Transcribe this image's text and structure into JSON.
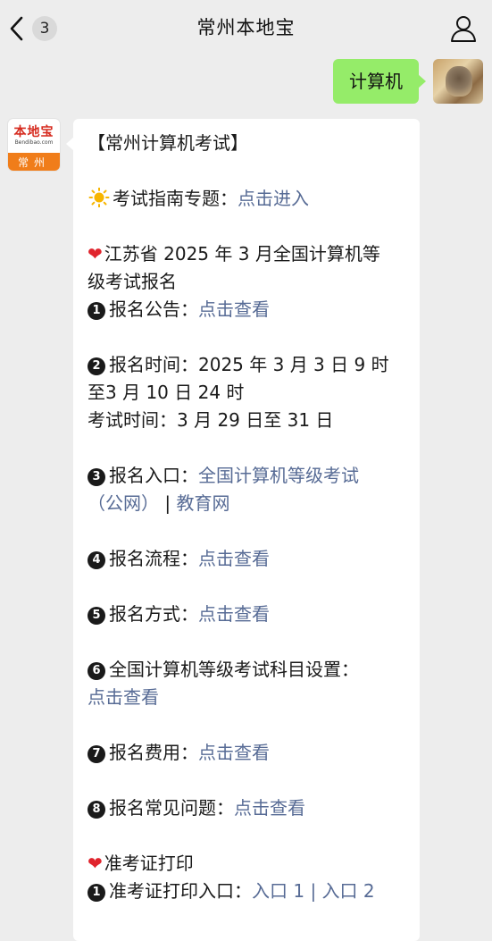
{
  "header": {
    "unread_count": "3",
    "title": "常州本地宝"
  },
  "outgoing": {
    "text": "计算机"
  },
  "bot_avatar": {
    "logo_text": "本地宝",
    "logo_sub": "Bendibao.com",
    "city": "常州"
  },
  "message": {
    "title": "【常州计算机考试】",
    "guide_label": "考试指南专题：",
    "guide_link": "点击进入",
    "reg_heading_1": "江苏省 2025 年 3 月全国计算机等",
    "reg_heading_2": "级考试报名",
    "items": [
      {
        "num": "1",
        "label": "报名公告：",
        "link": "点击查看"
      },
      {
        "num": "2",
        "label": "报名时间：2025 年 3 月 3 日 9 时",
        "line2": "至3 月 10 日 24 时",
        "line3": "考试时间：3 月 29 日至 31 日"
      },
      {
        "num": "3",
        "label": "报名入口：",
        "link": "全国计算机等级考试",
        "link_cont": "（公网）",
        "sep": " | ",
        "link2": "教育网"
      },
      {
        "num": "4",
        "label": "报名流程：",
        "link": "点击查看"
      },
      {
        "num": "5",
        "label": "报名方式：",
        "link": "点击查看"
      },
      {
        "num": "6",
        "label": "全国计算机等级考试科目设置：",
        "link": "点击查看"
      },
      {
        "num": "7",
        "label": "报名费用：",
        "link": "点击查看"
      },
      {
        "num": "8",
        "label": "报名常见问题：",
        "link": "点击查看"
      }
    ],
    "ticket_heading": "准考证打印",
    "ticket_item": {
      "num": "1",
      "label": "准考证打印入口：",
      "link1": "入口 1",
      "sep": " | ",
      "link2": "入口 2"
    }
  },
  "icons": {
    "back": "chevron-left-icon",
    "profile": "person-icon",
    "heart": "heart-icon",
    "sun": "sun-icon"
  },
  "colors": {
    "background": "#ededed",
    "outgoing_bubble": "#95ec69",
    "link": "#576b95",
    "heart": "#e0242d",
    "brand_orange": "#f07d1a"
  }
}
